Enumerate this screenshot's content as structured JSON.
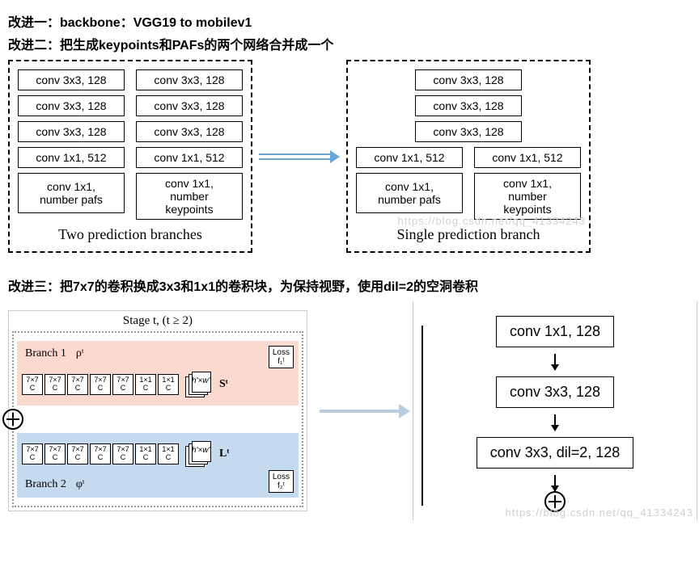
{
  "headings": {
    "h1": "改进一：backbone：VGG19 to mobilev1",
    "h2": "改进二：把生成keypoints和PAFs的两个网络合并成一个",
    "h3": "改进三：把7x7的卷积换成3x3和1x1的卷积块，为保持视野，使用dil=2的空洞卷积"
  },
  "twoBranches": {
    "caption": "Two prediction branches",
    "left": [
      "conv 3x3, 128",
      "conv 3x3, 128",
      "conv 3x3, 128",
      "conv 1x1, 512",
      "conv 1x1,\nnumber pafs"
    ],
    "right": [
      "conv 3x3, 128",
      "conv 3x3, 128",
      "conv 3x3, 128",
      "conv 1x1, 512",
      "conv 1x1,\nnumber\nkeypoints"
    ]
  },
  "singleBranch": {
    "caption": "Single prediction branch",
    "top": [
      "conv 3x3, 128",
      "conv 3x3, 128",
      "conv 3x3, 128"
    ],
    "bottomLeft": [
      "conv 1x1, 512",
      "conv 1x1,\nnumber pafs"
    ],
    "bottomRight": [
      "conv 1x1, 512",
      "conv 1x1,\nnumber\nkeypoints"
    ]
  },
  "stage": {
    "title": "Stage t, (t ≥ 2)",
    "branch1": {
      "label": "Branch 1",
      "sym": "ρᵗ",
      "loss": "Loss\nf₁ᵗ",
      "out": "Sᵗ",
      "dim": "h'×w'"
    },
    "branch2": {
      "label": "Branch 2",
      "sym": "φᵗ",
      "loss": "Loss\nf₂ᵗ",
      "out": "Lᵗ",
      "dim": "h'×w'"
    },
    "convs7": "7×7\nC",
    "convs1": "1×1\nC"
  },
  "flow": {
    "b1": "conv 1x1, 128",
    "b2": "conv 3x3, 128",
    "b3": "conv 3x3, dil=2, 128"
  },
  "watermark": "https://blog.csdn.net/qq_41334243"
}
